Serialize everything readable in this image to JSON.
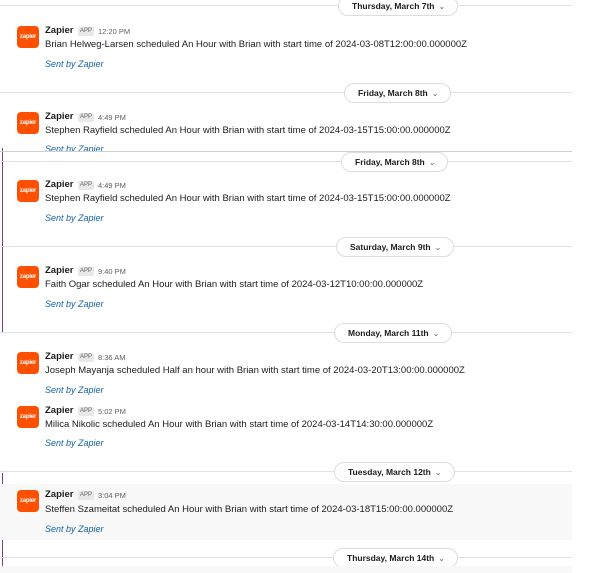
{
  "app": {
    "name": "Zapier",
    "badge": "APP",
    "logo_text": "zapier",
    "sent_label": "Sent by Zapier"
  },
  "dates": [
    "Thursday, March 7th",
    "Friday, March 8th",
    "Friday, March 8th",
    "Saturday, March 9th",
    "Monday, March 11th",
    "Tuesday, March 12th",
    "Thursday, March 14th"
  ],
  "messages": [
    {
      "time": "12:20 PM",
      "text": "Brian Helweg-Larsen scheduled An Hour with Brian with start time of 2024-03-08T12:00:00.000000Z"
    },
    {
      "time": "4:49 PM",
      "text": "Stephen Rayfield scheduled An Hour with Brian with start time of 2024-03-15T15:00:00.000000Z"
    },
    {
      "time": "4:49 PM",
      "text": "Stephen Rayfield scheduled An Hour with Brian with start time of 2024-03-15T15:00:00.000000Z"
    },
    {
      "time": "9:40 PM",
      "text": "Faith Ogar scheduled An Hour with Brian with start time of 2024-03-12T10:00:00.000000Z"
    },
    {
      "time": "8:36 AM",
      "text": "Joseph Mayanja scheduled Half an hour with Brian with start time of 2024-03-20T13:00:00.000000Z"
    },
    {
      "time": "5:02 PM",
      "text": "Milica Nikolic scheduled An Hour with Brian with start time of 2024-03-14T14:30:00.000000Z"
    },
    {
      "time": "3:04 PM",
      "text": "Steffen Szameitat scheduled An Hour with Brian with start time of 2024-03-18T15:00:00.000000Z"
    }
  ],
  "colors": {
    "brand": "#ff4f00",
    "link": "#1264a3",
    "accent_line": "#7a3f8a"
  }
}
